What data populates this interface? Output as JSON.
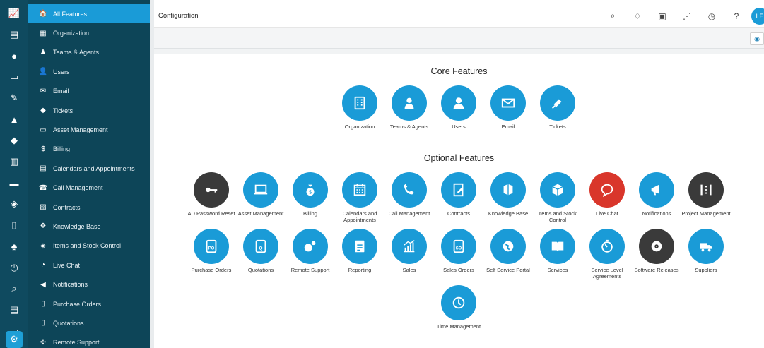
{
  "colors": {
    "rail_bg": "#0f4a5f",
    "sidebar_bg": "#0d4558",
    "accent_blue": "#1a9bd7",
    "dark_feature": "#3a3a3a",
    "red_feature": "#d9362b"
  },
  "rail": {
    "items": [
      {
        "icon": "chart-icon"
      },
      {
        "icon": "calendar-icon"
      },
      {
        "icon": "user-icon"
      },
      {
        "icon": "monitor-icon"
      },
      {
        "icon": "edit-icon"
      },
      {
        "icon": "thumbs-up-icon"
      },
      {
        "icon": "box-icon"
      },
      {
        "icon": "book-icon"
      },
      {
        "icon": "truck-icon"
      },
      {
        "icon": "cube-icon"
      },
      {
        "icon": "quote-icon"
      },
      {
        "icon": "money-bag-icon"
      },
      {
        "icon": "clock-icon"
      },
      {
        "icon": "search-icon"
      },
      {
        "icon": "document-icon"
      },
      {
        "icon": "desktop-icon"
      },
      {
        "icon": "settings-icon"
      }
    ]
  },
  "sidebar": {
    "items": [
      {
        "label": "All Features",
        "icon": "home-icon",
        "glyph": "🏠"
      },
      {
        "label": "Organization",
        "icon": "building-icon",
        "glyph": "▦"
      },
      {
        "label": "Teams & Agents",
        "icon": "agent-icon",
        "glyph": "♟"
      },
      {
        "label": "Users",
        "icon": "user-icon",
        "glyph": "👤"
      },
      {
        "label": "Email",
        "icon": "email-icon",
        "glyph": "✉"
      },
      {
        "label": "Tickets",
        "icon": "ticket-icon",
        "glyph": "◆"
      },
      {
        "label": "Asset Management",
        "icon": "monitor-icon",
        "glyph": "▭"
      },
      {
        "label": "Billing",
        "icon": "money-bag-icon",
        "glyph": "$"
      },
      {
        "label": "Calendars and Appointments",
        "icon": "calendar-icon",
        "glyph": "▤"
      },
      {
        "label": "Call Management",
        "icon": "phone-icon",
        "glyph": "☎"
      },
      {
        "label": "Contracts",
        "icon": "contract-icon",
        "glyph": "▨"
      },
      {
        "label": "Knowledge Base",
        "icon": "knowledge-icon",
        "glyph": "❖"
      },
      {
        "label": "Items and Stock Control",
        "icon": "cube-icon",
        "glyph": "◈"
      },
      {
        "label": "Live Chat",
        "icon": "chat-icon",
        "glyph": "◔"
      },
      {
        "label": "Notifications",
        "icon": "megaphone-icon",
        "glyph": "◀"
      },
      {
        "label": "Purchase Orders",
        "icon": "po-icon",
        "glyph": "▯"
      },
      {
        "label": "Quotations",
        "icon": "quote-icon",
        "glyph": "▯"
      },
      {
        "label": "Remote Support",
        "icon": "remote-icon",
        "glyph": "✣"
      }
    ]
  },
  "topbar": {
    "title": "Configuration",
    "tools": [
      "search-icon",
      "bell-icon",
      "clipboard-icon",
      "rss-icon",
      "clock-icon",
      "help-icon"
    ],
    "avatar": "LE"
  },
  "core": {
    "title": "Core Features",
    "items": [
      {
        "label": "Organization",
        "icon": "building-icon",
        "color": "#1a9bd7"
      },
      {
        "label": "Teams & Agents",
        "icon": "agent-icon",
        "color": "#1a9bd7"
      },
      {
        "label": "Users",
        "icon": "user-icon",
        "color": "#1a9bd7"
      },
      {
        "label": "Email",
        "icon": "email-icon",
        "color": "#1a9bd7"
      },
      {
        "label": "Tickets",
        "icon": "ticket-icon",
        "color": "#1a9bd7"
      }
    ]
  },
  "optional": {
    "title": "Optional Features",
    "rows": [
      [
        {
          "label": "AD Password Reset",
          "icon": "key-icon",
          "color": "#3a3a3a"
        },
        {
          "label": "Asset Management",
          "icon": "monitor-icon",
          "color": "#1a9bd7"
        },
        {
          "label": "Billing",
          "icon": "money-bag-icon",
          "color": "#1a9bd7"
        },
        {
          "label": "Calendars and Appointments",
          "icon": "calendar-icon",
          "color": "#1a9bd7"
        },
        {
          "label": "Call Management",
          "icon": "phone-icon",
          "color": "#1a9bd7"
        },
        {
          "label": "Contracts",
          "icon": "contract-icon",
          "color": "#1a9bd7"
        },
        {
          "label": "Knowledge Base",
          "icon": "knowledge-icon",
          "color": "#1a9bd7"
        },
        {
          "label": "Items and Stock Control",
          "icon": "cube-icon",
          "color": "#1a9bd7"
        },
        {
          "label": "Live Chat",
          "icon": "chat-icon",
          "color": "#d9362b"
        },
        {
          "label": "Notifications",
          "icon": "megaphone-icon",
          "color": "#1a9bd7"
        },
        {
          "label": "Project Management",
          "icon": "kanban-icon",
          "color": "#3a3a3a"
        }
      ],
      [
        {
          "label": "Purchase Orders",
          "icon": "po-icon",
          "color": "#1a9bd7"
        },
        {
          "label": "Quotations",
          "icon": "quote-icon",
          "color": "#1a9bd7"
        },
        {
          "label": "Remote Support",
          "icon": "remote-icon",
          "color": "#1a9bd7"
        },
        {
          "label": "Reporting",
          "icon": "report-icon",
          "color": "#1a9bd7"
        },
        {
          "label": "Sales",
          "icon": "sales-chart-icon",
          "color": "#1a9bd7"
        },
        {
          "label": "Sales Orders",
          "icon": "so-icon",
          "color": "#1a9bd7"
        },
        {
          "label": "Self Service Portal",
          "icon": "globe-icon",
          "color": "#1a9bd7"
        },
        {
          "label": "Services",
          "icon": "book-icon",
          "color": "#1a9bd7"
        },
        {
          "label": "Service Level Agreements",
          "icon": "timer-icon",
          "color": "#1a9bd7"
        },
        {
          "label": "Software Releases",
          "icon": "disc-icon",
          "color": "#3a3a3a"
        },
        {
          "label": "Suppliers",
          "icon": "truck-icon",
          "color": "#1a9bd7"
        }
      ],
      [
        {
          "label": "Time Management",
          "icon": "clock-icon",
          "color": "#1a9bd7"
        }
      ]
    ]
  }
}
